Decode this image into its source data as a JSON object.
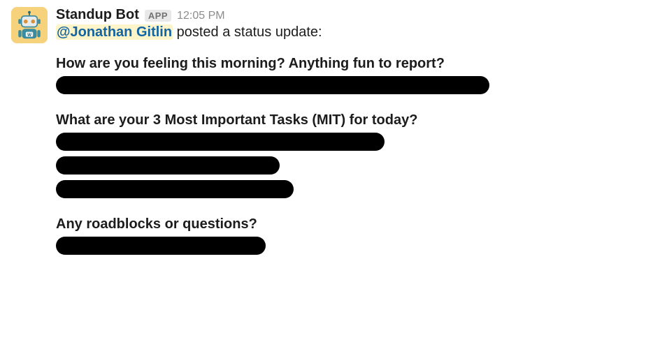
{
  "author": "Standup Bot",
  "app_badge": "APP",
  "timestamp": "12:05 PM",
  "mention": "@Jonathan Gitlin",
  "intro_suffix": " posted a status update:",
  "sections": {
    "q1": "How are you feeling this morning? Anything fun to report?",
    "q2": "What are your 3 Most Important Tasks (MIT) for today?",
    "q3": "Any roadblocks or questions?"
  }
}
